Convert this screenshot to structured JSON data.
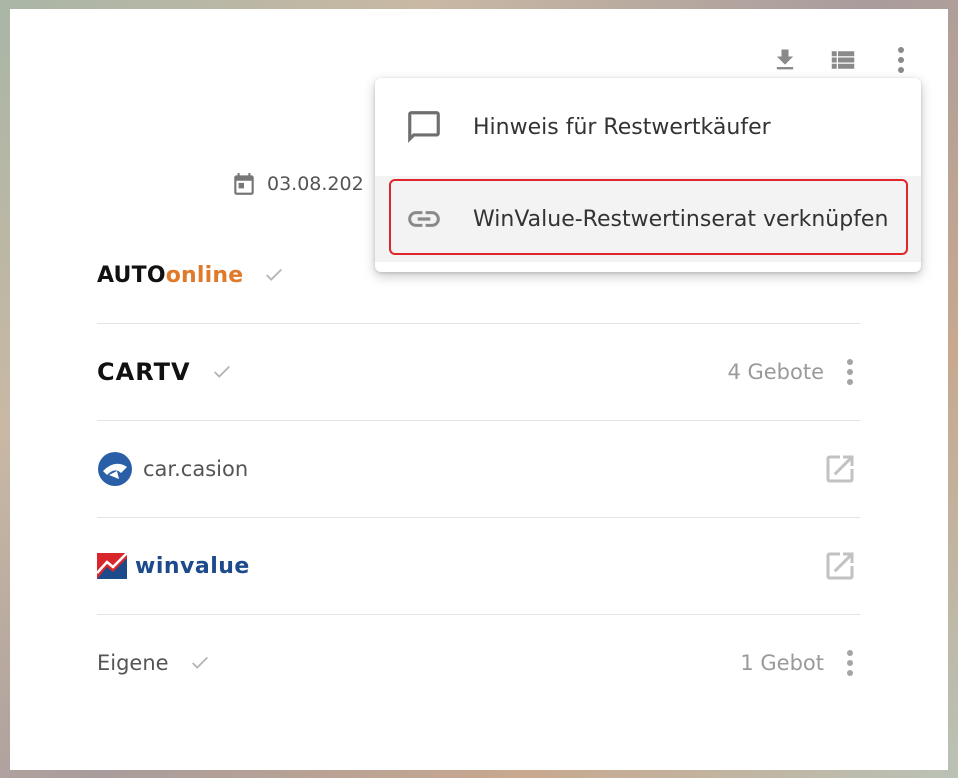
{
  "toolbar": {
    "icons": [
      "download-icon",
      "list-view-icon",
      "more-vert-icon"
    ]
  },
  "date": {
    "value": "03.08.202",
    "icon": "calendar-icon"
  },
  "rows": [
    {
      "logo_a": "AUTO",
      "logo_b": "online",
      "checked": true,
      "bids": ""
    },
    {
      "logo": "CARTV",
      "checked": true,
      "bids": "4 Gebote"
    },
    {
      "logo": "car.casion",
      "checked": false,
      "bids": ""
    },
    {
      "logo": "winvalue",
      "checked": false,
      "bids": ""
    },
    {
      "label": "Eigene",
      "checked": true,
      "bids": "1 Gebot"
    }
  ],
  "menu": {
    "items": [
      {
        "label": "Hinweis für Restwertkäufer",
        "icon": "comment-icon"
      },
      {
        "label": "WinValue-Restwertinserat verknüpfen",
        "icon": "link-icon"
      }
    ]
  },
  "colors": {
    "accent_orange": "#e07a2a",
    "winvalue_blue": "#1d4a8a",
    "highlight_red": "#e0262b"
  }
}
